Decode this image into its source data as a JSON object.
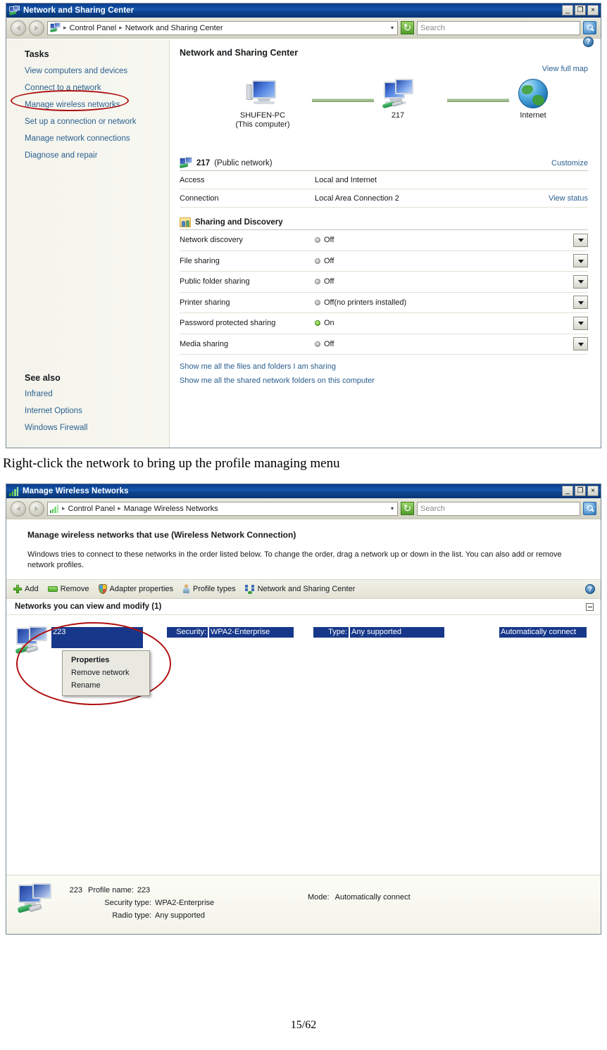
{
  "page": {
    "footer": "15/62"
  },
  "caption": "Right-click the network to bring up the profile managing menu",
  "window1": {
    "title": "Network and Sharing Center",
    "controls": {
      "minimize": "_",
      "maximize": "❐",
      "close": "×"
    },
    "address": {
      "root": "Control Panel",
      "leaf": "Network and Sharing Center",
      "separator": "▸",
      "dropdown": "▾",
      "search_placeholder": "Search"
    },
    "sidebar": {
      "tasks_heading": "Tasks",
      "tasks": [
        "View computers and devices",
        "Connect to a network",
        "Manage wireless networks",
        "Set up a connection or network",
        "Manage network connections",
        "Diagnose and repair"
      ],
      "see_also_heading": "See also",
      "see_also": [
        "Infrared",
        "Internet Options",
        "Windows Firewall"
      ]
    },
    "main": {
      "title": "Network and Sharing Center",
      "help_glyph": "?",
      "view_full_map": "View full map",
      "map": {
        "nodes": [
          {
            "label1": "SHUFEN-PC",
            "label2": "(This computer)"
          },
          {
            "label1": "217",
            "label2": ""
          },
          {
            "label1": "Internet",
            "label2": ""
          }
        ]
      },
      "network": {
        "name": "217",
        "kind": "(Public network)",
        "customize": "Customize",
        "rows": [
          {
            "key": "Access",
            "value": "Local and Internet",
            "action": ""
          },
          {
            "key": "Connection",
            "value": "Local Area Connection 2",
            "action": "View status"
          }
        ]
      },
      "sharing": {
        "heading": "Sharing and Discovery",
        "rows": [
          {
            "key": "Network discovery",
            "state": "Off",
            "on": false
          },
          {
            "key": "File sharing",
            "state": "Off",
            "on": false
          },
          {
            "key": "Public folder sharing",
            "state": "Off",
            "on": false
          },
          {
            "key": "Printer sharing",
            "state": "Off(no printers installed)",
            "on": false
          },
          {
            "key": "Password protected sharing",
            "state": "On",
            "on": true
          },
          {
            "key": "Media sharing",
            "state": "Off",
            "on": false
          }
        ]
      },
      "bottom_links": [
        "Show me all the files and folders I am sharing",
        "Show me all the shared network folders on this computer"
      ]
    }
  },
  "window2": {
    "title": "Manage Wireless Networks",
    "controls": {
      "minimize": "_",
      "maximize": "❐",
      "close": "×"
    },
    "address": {
      "root": "Control Panel",
      "leaf": "Manage Wireless Networks",
      "separator": "▸",
      "dropdown": "▾",
      "search_placeholder": "Search"
    },
    "heading": "Manage wireless networks that use (Wireless Network Connection)",
    "description": "Windows tries to connect to these networks in the order listed below. To change the order, drag a network up or down in the list. You can also add or remove network profiles.",
    "toolbar": [
      {
        "label": "Add",
        "icon": "plus-icon"
      },
      {
        "label": "Remove",
        "icon": "minus-icon"
      },
      {
        "label": "Adapter properties",
        "icon": "shield-icon"
      },
      {
        "label": "Profile types",
        "icon": "person-icon"
      },
      {
        "label": "Network and Sharing Center",
        "icon": "network-icon"
      }
    ],
    "toolbar_help_glyph": "?",
    "group_header": "Networks you can view and modify (1)",
    "network_row": {
      "name": "223",
      "security_label": "Security:",
      "security_value": "WPA2-Enterprise",
      "type_label": "Type:",
      "type_value": "Any supported",
      "mode": "Automatically connect"
    },
    "context_menu": [
      "Properties",
      "Remove network",
      "Rename"
    ],
    "details": {
      "name": "223",
      "rows": [
        {
          "label": "Profile name:",
          "value": "223"
        },
        {
          "label": "Security type:",
          "value": "WPA2-Enterprise"
        },
        {
          "label": "Radio type:",
          "value": "Any supported"
        }
      ],
      "mode_label": "Mode:",
      "mode_value": "Automatically connect"
    }
  }
}
